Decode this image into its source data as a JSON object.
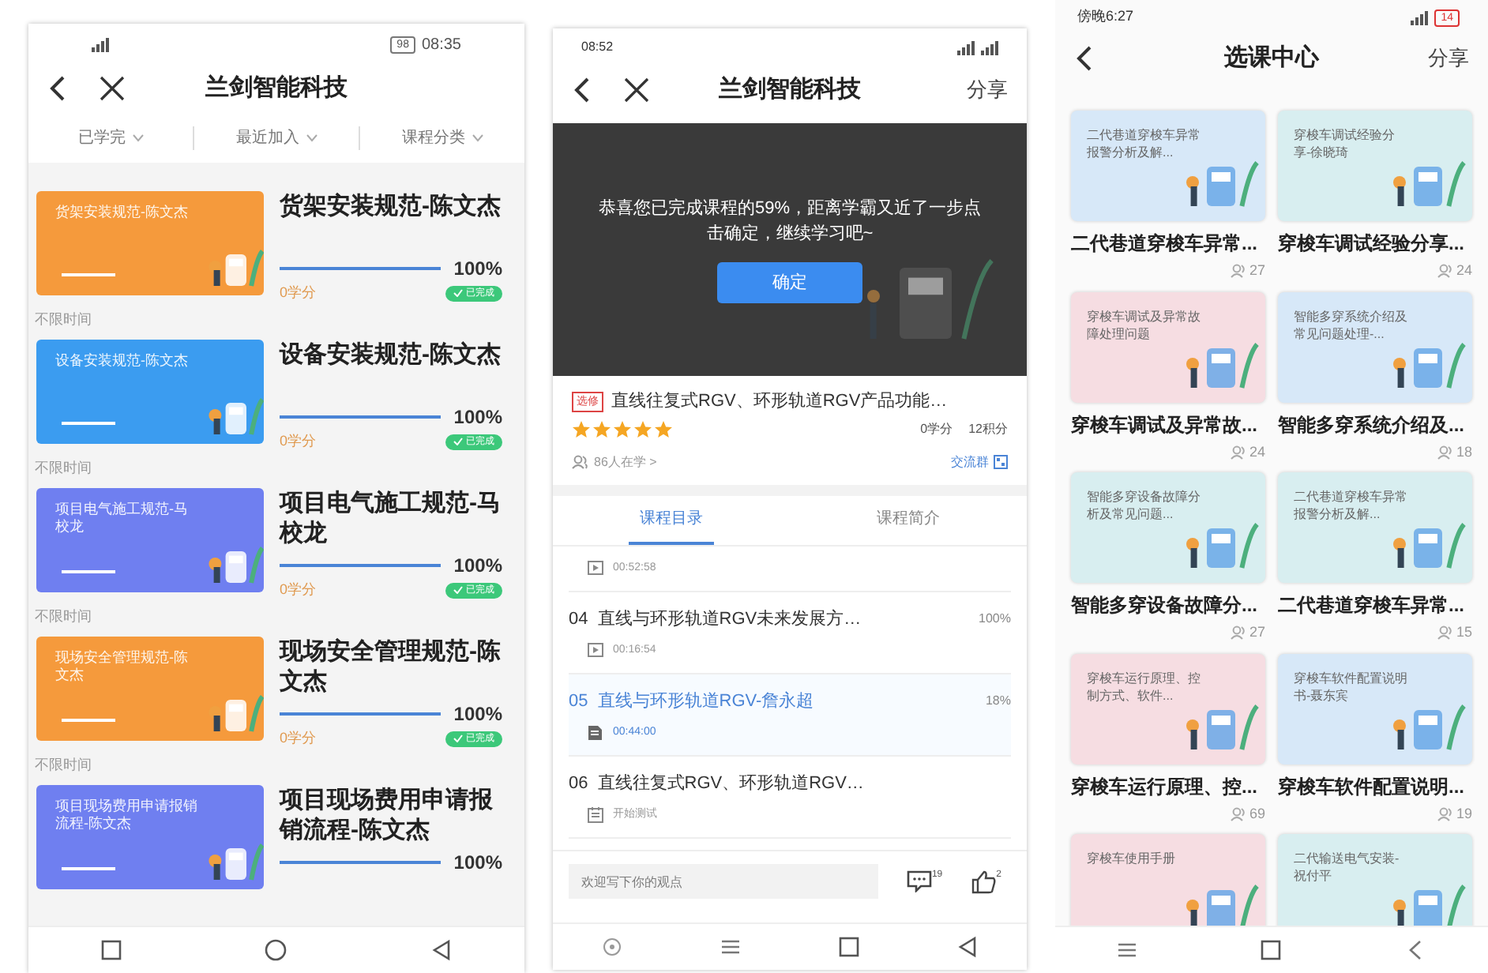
{
  "phones": [
    {
      "kind": "my_courses",
      "status_bar": {
        "time": "08:35",
        "battery": "98"
      },
      "nav": {
        "title": "兰剑智能科技"
      },
      "filters": [
        "已学完",
        "最近加入",
        "课程分类"
      ],
      "courses": [
        {
          "color": "#f59a3c",
          "thumb_text": "货架安装规范-陈文杰",
          "title": "货架安装规范-陈文杰",
          "level": 1,
          "percent": "100%",
          "credits": "0学分",
          "badge": "已完成",
          "time_limit": "不限时间"
        },
        {
          "color": "#3b9cf0",
          "thumb_text": "设备安装规范-陈文杰",
          "title": "设备安装规范-陈文杰",
          "level": 1,
          "percent": "100%",
          "credits": "0学分",
          "badge": "已完成",
          "time_limit": "不限时间"
        },
        {
          "color": "#6f7ff0",
          "thumb_text": "项目电气施工规范-马校龙",
          "title": "项目电气施工规范-马校龙",
          "level": 1,
          "percent": "100%",
          "credits": "0学分",
          "badge": "已完成",
          "time_limit": "不限时间"
        },
        {
          "color": "#f59a3c",
          "thumb_text": "现场安全管理规范-陈文杰",
          "title": "现场安全管理规范-陈文杰",
          "level": 1,
          "percent": "100%",
          "credits": "0学分",
          "badge": "已完成",
          "time_limit": "不限时间"
        },
        {
          "color": "#6f7ff0",
          "thumb_text": "项目现场费用申请报销流程-陈文杰",
          "title": "项目现场费用申请报销流程-陈文杰",
          "level": 1,
          "percent": "100%"
        }
      ]
    },
    {
      "kind": "course_detail",
      "status_bar": {
        "time": "08:52"
      },
      "nav": {
        "title": "兰剑智能科技",
        "action": "分享"
      },
      "dialog": {
        "message": "恭喜您已完成课程的59%，距离学霸又近了一步点击确定，继续学习吧~",
        "button": "确定"
      },
      "course": {
        "tag": "选修",
        "title": "直线往复式RGV、环形轨道RGV产品功能…",
        "stars": 5,
        "credits": "0学分",
        "points": "12积分",
        "learners": "86人在学 >",
        "group": "交流群"
      },
      "tabs": [
        {
          "label": "课程目录",
          "selected": true
        },
        {
          "label": "课程简介",
          "selected": false
        }
      ],
      "lessons": [
        {
          "kind": "video",
          "duration": "00:52:58",
          "current": false
        },
        {
          "kind": "video",
          "number": "04",
          "title": "直线与环形轨道RGV未来发展方…",
          "progress": "100%",
          "duration": "00:16:54",
          "current": false
        },
        {
          "kind": "document",
          "number": "05",
          "title": "直线与环形轨道RGV-詹永超",
          "progress": "18%",
          "duration": "00:44:00",
          "current": true
        },
        {
          "kind": "quiz",
          "number": "06",
          "title": "直线往复式RGV、环形轨道RGV…",
          "duration": "开始测试",
          "current": false
        }
      ],
      "comment": {
        "placeholder": "欢迎写下你的观点",
        "comments": "19",
        "likes": "2"
      }
    },
    {
      "kind": "course_center",
      "status_bar": {
        "time": "傍晚6:27",
        "battery": "14"
      },
      "nav": {
        "title": "选课中心",
        "action": "分享"
      },
      "cards": [
        {
          "color": "#d7e8f8",
          "thumb_text": "二代巷道穿梭车异常报警分析及解...",
          "title": "二代巷道穿梭车异常...",
          "learners": "27"
        },
        {
          "color": "#d8eef0",
          "thumb_text": "穿梭车调试经验分享-徐晓琦",
          "title": "穿梭车调试经验分享...",
          "learners": "24"
        },
        {
          "color": "#f6dde2",
          "thumb_text": "穿梭车调试及异常故障处理问题",
          "title": "穿梭车调试及异常故...",
          "learners": "24"
        },
        {
          "color": "#d7e8f8",
          "thumb_text": "智能多穿系统介绍及常见问题处理-...",
          "title": "智能多穿系统介绍及...",
          "learners": "18"
        },
        {
          "color": "#d8eef0",
          "thumb_text": "智能多穿设备故障分析及常见问题...",
          "title": "智能多穿设备故障分...",
          "learners": "27"
        },
        {
          "color": "#d8eef0",
          "thumb_text": "二代巷道穿梭车异常报警分析及解...",
          "title": "二代巷道穿梭车异常...",
          "learners": "15"
        },
        {
          "color": "#f6dde2",
          "thumb_text": "穿梭车运行原理、控制方式、软件...",
          "title": "穿梭车运行原理、控...",
          "learners": "69"
        },
        {
          "color": "#d7e8f8",
          "thumb_text": "穿梭车软件配置说明书-聂东宾",
          "title": "穿梭车软件配置说明...",
          "learners": "19"
        },
        {
          "color": "#f6dde2",
          "thumb_text": "穿梭车使用手册"
        },
        {
          "color": "#d8eef0",
          "thumb_text": "二代输送电气安装-祝付平"
        }
      ]
    }
  ]
}
